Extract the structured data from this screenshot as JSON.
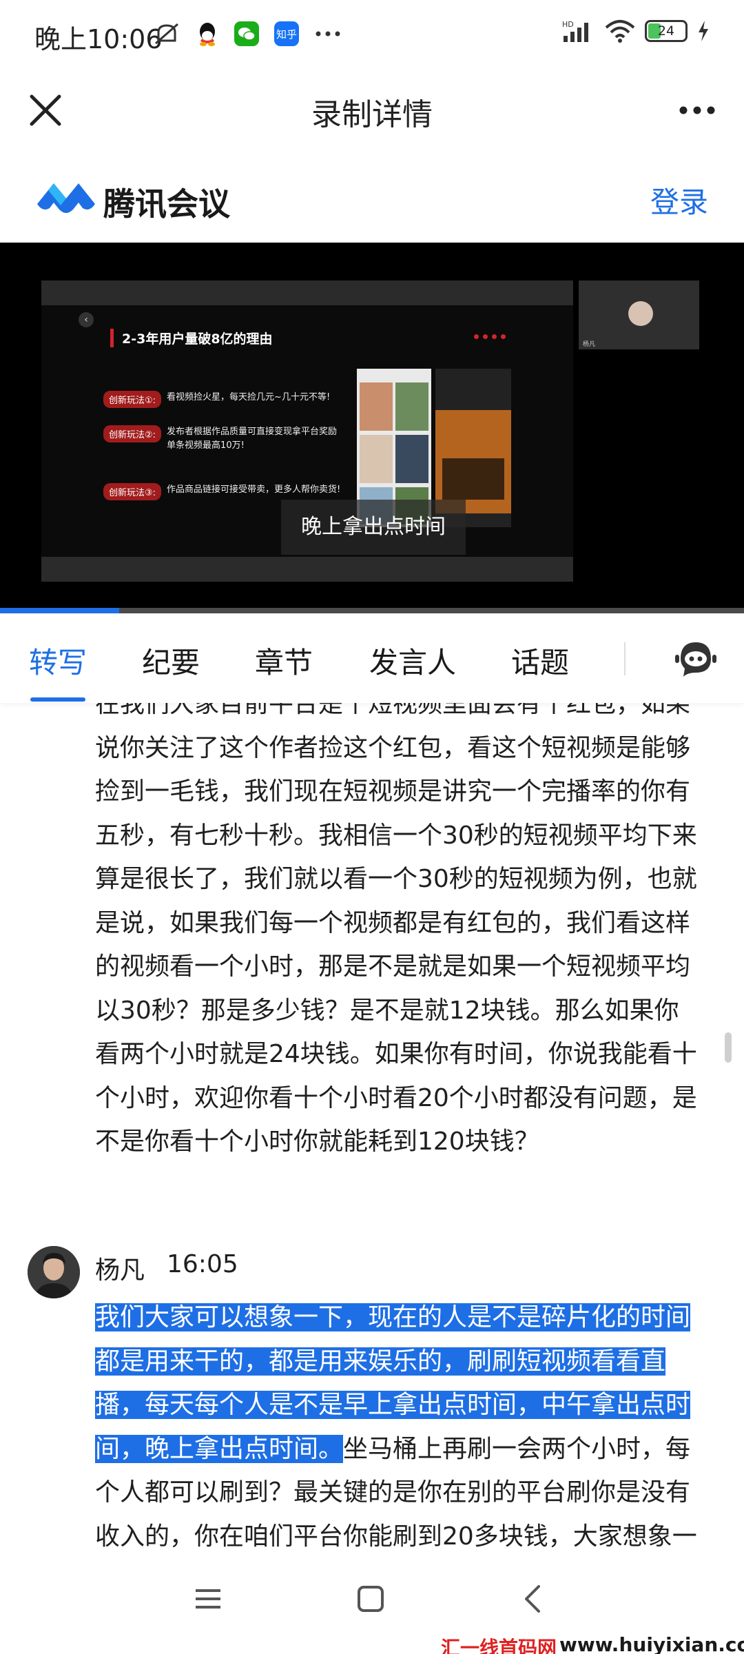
{
  "status_bar": {
    "time": "晚上10:06",
    "app_icons": [
      "mute-icon",
      "qq-icon",
      "wechat-icon",
      "zhihu-icon",
      "more-dots-icon"
    ],
    "zhihu_label": "知乎",
    "network": "HD",
    "battery_level": "24"
  },
  "header": {
    "title": "录制详情"
  },
  "brand": {
    "name": "腾讯会议",
    "login": "登录"
  },
  "video": {
    "slide_title": "2-3年用户量破8亿的理由",
    "rows": [
      {
        "tag": "创新玩法①:",
        "text": "看视频捡火星，每天捡几元~几十元不等!"
      },
      {
        "tag": "创新玩法②:",
        "text": "发布者根据作品质量可直接变现拿平台奖励",
        "text2": "单条视频最高10万!"
      },
      {
        "tag": "创新玩法③:",
        "text": "作品商品链接可接受带卖，更多人帮你卖货!"
      }
    ],
    "caption": "晚上拿出点时间",
    "speaker_tile_label": "杨凡",
    "progress": 0.16
  },
  "tabs": {
    "items": [
      "转写",
      "纪要",
      "章节",
      "发言人",
      "话题"
    ],
    "active": "转写"
  },
  "transcript": {
    "prev_paragraph": "在我们大家目前平台是个短视频里面会有个红包，如果说你关注了这个作者捡这个红包，看这个短视频是能够捡到一毛钱，我们现在短视频是讲究一个完播率的你有五秒，有七秒十秒。我相信一个30秒的短视频平均下来算是很长了，我们就以看一个30秒的短视频为例，也就是说，如果我们每一个视频都是有红包的，我们看这样的视频看一个小时，那是不是就是如果一个短视频平均以30秒？那是多少钱？是不是就12块钱。那么如果你看两个小时就是24块钱。如果你有时间，你说我能看十个小时，欢迎你看十个小时看20个小时都没有问题，是不是你看十个小时你就能耗到120块钱？",
    "speaker_name": "杨凡",
    "speaker_time": "16:05",
    "highlighted": "我们大家可以想象一下，现在的人是不是碎片化的时间都是用来干的，都是用来娱乐的，刷刷短视频看看直播，每天每个人是不是早上拿出点时间，中午拿出点时间，晚上拿出点时间。",
    "rest": "坐马桶上再刷一会两个小时，每个人都可以刷到？最关键的是你在别的平台刷你是没有收入的，你在咱们平台你能刷到20多块钱，大家想象一下就这个红包能用来做一下早饭，你这个是不是就可以了？"
  },
  "nav": {
    "buttons": [
      "menu-icon",
      "home-icon",
      "back-icon"
    ]
  },
  "watermark": {
    "part1": "汇一线首码网",
    "part2": "www.huiyixian.com"
  }
}
